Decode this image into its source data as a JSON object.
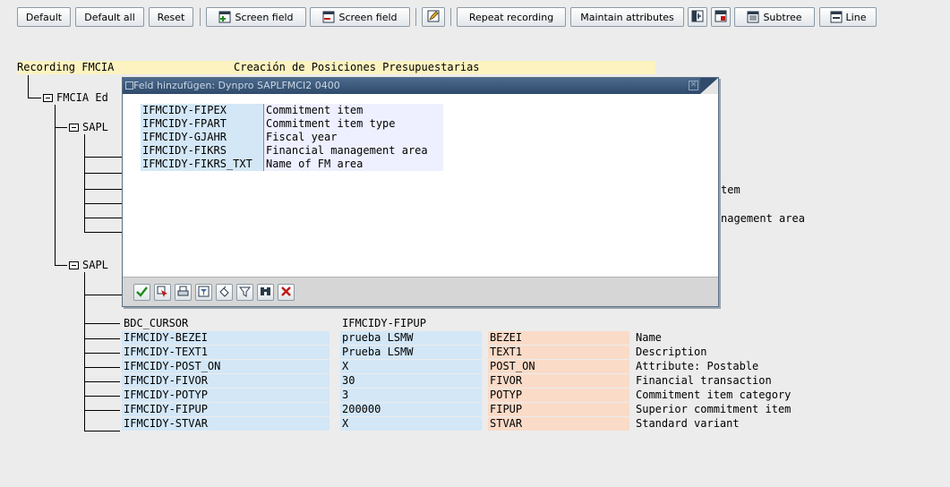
{
  "toolbar": {
    "default": "Default",
    "default_all": "Default all",
    "reset": "Reset",
    "screen_field_1": "Screen field",
    "screen_field_2": "Screen field",
    "repeat_recording": "Repeat recording",
    "maintain_attributes": "Maintain attributes",
    "subtree": "Subtree",
    "line": "Line"
  },
  "header": {
    "recording": "Recording FMCIA",
    "description": "Creación de Posiciones Presupuestarias"
  },
  "tree": {
    "node_fmcia": "FMCIA Ed",
    "node_sapl_1": "SAPL",
    "node_sapl_2": "SAPL",
    "partial_1": "tem",
    "partial_2": "nagement area",
    "rows": [
      {
        "field": "BDC_CURSOR",
        "value": "IFMCIDY-FIPUP",
        "attr": "",
        "text": ""
      },
      {
        "field": "IFMCIDY-BEZEI",
        "value": "prueba LSMW",
        "attr": "BEZEI",
        "text": "Name"
      },
      {
        "field": "IFMCIDY-TEXT1",
        "value": "Prueba LSMW",
        "attr": "TEXT1",
        "text": "Description"
      },
      {
        "field": "IFMCIDY-POST_ON",
        "value": "X",
        "attr": "POST_ON",
        "text": "Attribute: Postable"
      },
      {
        "field": "IFMCIDY-FIVOR",
        "value": "30",
        "attr": "FIVOR",
        "text": "Financial transaction"
      },
      {
        "field": "IFMCIDY-POTYP",
        "value": "3",
        "attr": "POTYP",
        "text": "Commitment item category"
      },
      {
        "field": "IFMCIDY-FIPUP",
        "value": "200000",
        "attr": "FIPUP",
        "text": "Superior commitment item"
      },
      {
        "field": "IFMCIDY-STVAR",
        "value": "X",
        "attr": "STVAR",
        "text": "Standard variant"
      }
    ]
  },
  "dialog": {
    "title": "Feld hinzufügen: Dynpro SAPLFMCI2 0400",
    "items": [
      {
        "field": "IFMCIDY-FIPEX",
        "desc": "Commitment item"
      },
      {
        "field": "IFMCIDY-FPART",
        "desc": "Commitment item type"
      },
      {
        "field": "IFMCIDY-GJAHR",
        "desc": "Fiscal year"
      },
      {
        "field": "IFMCIDY-FIKRS",
        "desc": "Financial management area"
      },
      {
        "field": "IFMCIDY-FIKRS_TXT",
        "desc": "Name of FM area"
      }
    ]
  },
  "colors": {
    "field_blue": "#d3e7f7",
    "attr_orange": "#fadbc8",
    "header_yellow": "#fcf3c0",
    "title_bar": "#3d5a7c"
  },
  "icons": [
    "screen-field-add-icon",
    "screen-field-remove-icon",
    "edit-icon",
    "expand-icon",
    "collapse-icon",
    "subtree-icon",
    "line-icon",
    "check-icon",
    "select-icon",
    "print-icon",
    "filter-icon",
    "refresh-icon",
    "funnel-icon",
    "find-icon",
    "cancel-icon"
  ]
}
